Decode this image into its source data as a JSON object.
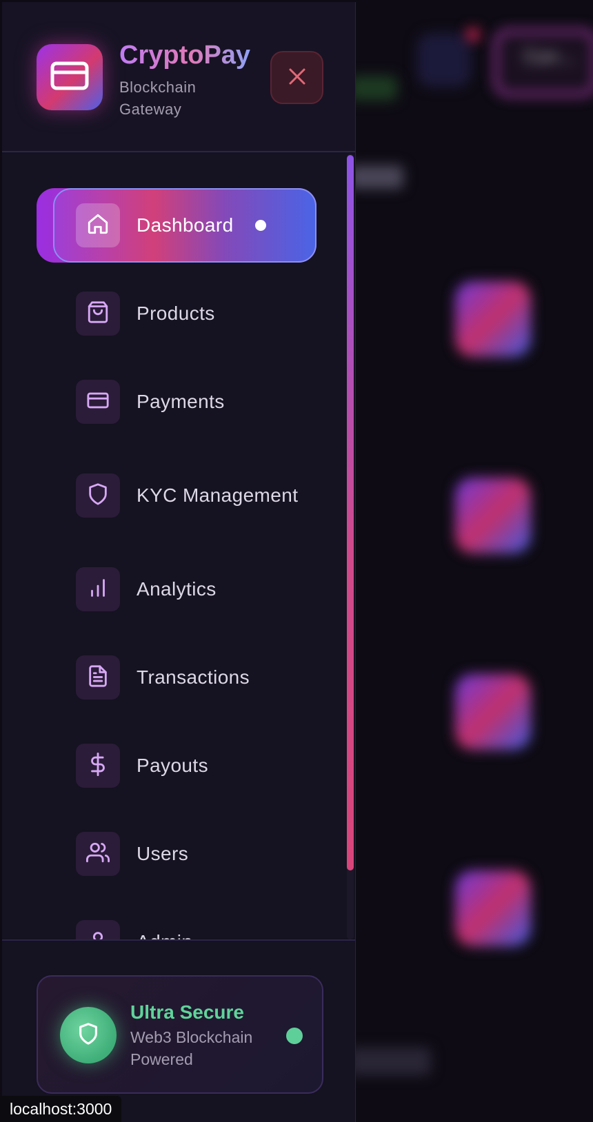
{
  "brand": {
    "title": "CryptoPay",
    "subtitle": "Blockchain Gateway",
    "logo_icon": "credit-card-icon"
  },
  "header": {
    "close_icon": "close-icon"
  },
  "nav": {
    "items": [
      {
        "label": "Dashboard",
        "icon": "home-icon",
        "active": true
      },
      {
        "label": "Products",
        "icon": "shopping-bag-icon",
        "active": false
      },
      {
        "label": "Payments",
        "icon": "credit-card-icon",
        "active": false
      },
      {
        "label": "KYC Management",
        "icon": "shield-icon",
        "active": false
      },
      {
        "label": "Analytics",
        "icon": "bar-chart-icon",
        "active": false
      },
      {
        "label": "Transactions",
        "icon": "file-text-icon",
        "active": false
      },
      {
        "label": "Payouts",
        "icon": "dollar-sign-icon",
        "active": false
      },
      {
        "label": "Users",
        "icon": "users-icon",
        "active": false
      },
      {
        "label": "Admin",
        "icon": "user-icon",
        "active": false
      }
    ]
  },
  "footer": {
    "title": "Ultra Secure",
    "subtitle": "Web3 Blockchain Powered",
    "icon": "shield-icon",
    "status_color": "#5fcf9a"
  },
  "background": {
    "connect_label": "Con..."
  },
  "status_bar": {
    "url": "localhost:3000"
  },
  "colors": {
    "accent_purple": "#9b33e6",
    "accent_pink": "#d33a6e",
    "accent_blue": "#4f5fe6",
    "success_green": "#5fd49a",
    "danger_red": "#e06a78"
  }
}
